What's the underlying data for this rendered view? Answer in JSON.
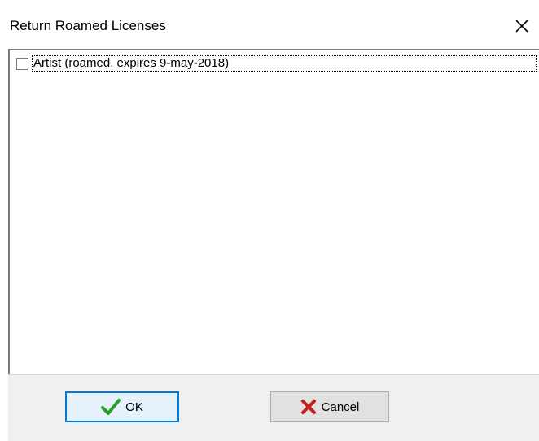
{
  "window": {
    "title": "Return Roamed Licenses",
    "close_icon": "close-icon"
  },
  "licenses": {
    "items": [
      {
        "label": "Artist (roamed, expires 9-may-2018)",
        "checked": false
      }
    ]
  },
  "buttons": {
    "ok_label": "OK",
    "ok_icon": "checkmark-icon",
    "cancel_label": "Cancel",
    "cancel_icon": "x-icon"
  },
  "colors": {
    "ok_border": "#0078d7",
    "ok_check": "#2a9d2a",
    "cancel_x": "#c41e1e",
    "panel_bg": "#f0f0f0"
  }
}
